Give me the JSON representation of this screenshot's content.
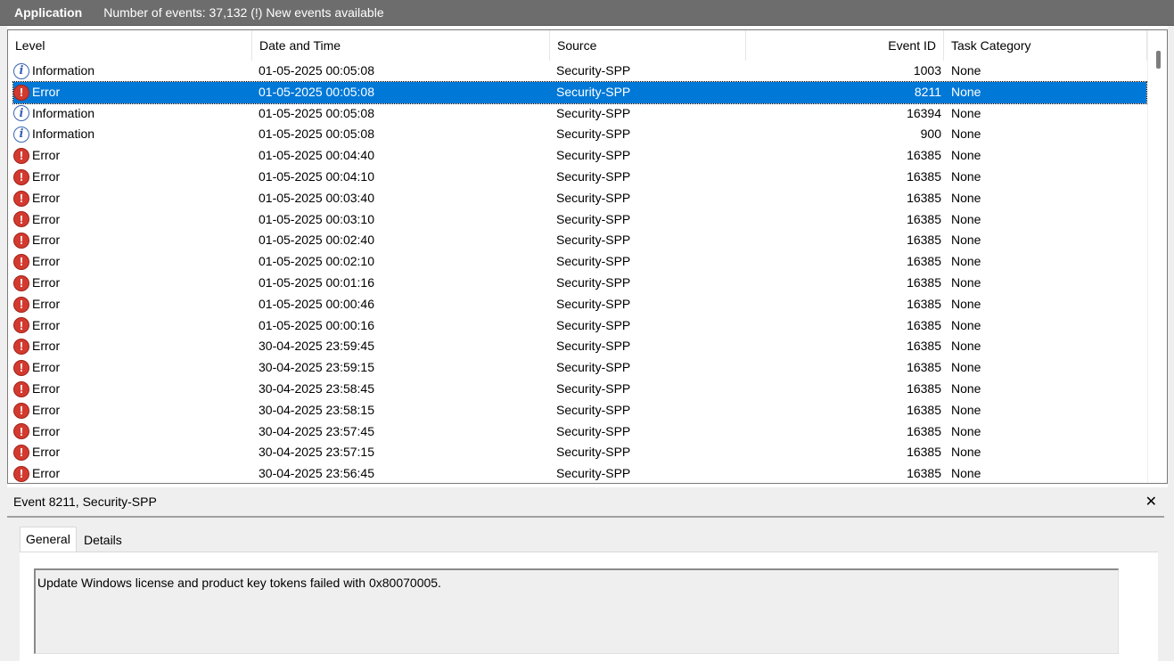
{
  "titlebar": {
    "log_name": "Application",
    "info": "Number of events: 37,132 (!) New events available"
  },
  "columns": {
    "level": "Level",
    "date": "Date and Time",
    "source": "Source",
    "event_id": "Event ID",
    "task": "Task Category"
  },
  "events": [
    {
      "level": "Information",
      "icon": "info",
      "date": "01-05-2025 00:05:08",
      "source": "Security-SPP",
      "id": "1003",
      "task": "None"
    },
    {
      "level": "Error",
      "icon": "error",
      "date": "01-05-2025 00:05:08",
      "source": "Security-SPP",
      "id": "8211",
      "task": "None",
      "selected": true
    },
    {
      "level": "Information",
      "icon": "info",
      "date": "01-05-2025 00:05:08",
      "source": "Security-SPP",
      "id": "16394",
      "task": "None"
    },
    {
      "level": "Information",
      "icon": "info",
      "date": "01-05-2025 00:05:08",
      "source": "Security-SPP",
      "id": "900",
      "task": "None"
    },
    {
      "level": "Error",
      "icon": "error",
      "date": "01-05-2025 00:04:40",
      "source": "Security-SPP",
      "id": "16385",
      "task": "None"
    },
    {
      "level": "Error",
      "icon": "error",
      "date": "01-05-2025 00:04:10",
      "source": "Security-SPP",
      "id": "16385",
      "task": "None"
    },
    {
      "level": "Error",
      "icon": "error",
      "date": "01-05-2025 00:03:40",
      "source": "Security-SPP",
      "id": "16385",
      "task": "None"
    },
    {
      "level": "Error",
      "icon": "error",
      "date": "01-05-2025 00:03:10",
      "source": "Security-SPP",
      "id": "16385",
      "task": "None"
    },
    {
      "level": "Error",
      "icon": "error",
      "date": "01-05-2025 00:02:40",
      "source": "Security-SPP",
      "id": "16385",
      "task": "None"
    },
    {
      "level": "Error",
      "icon": "error",
      "date": "01-05-2025 00:02:10",
      "source": "Security-SPP",
      "id": "16385",
      "task": "None"
    },
    {
      "level": "Error",
      "icon": "error",
      "date": "01-05-2025 00:01:16",
      "source": "Security-SPP",
      "id": "16385",
      "task": "None"
    },
    {
      "level": "Error",
      "icon": "error",
      "date": "01-05-2025 00:00:46",
      "source": "Security-SPP",
      "id": "16385",
      "task": "None"
    },
    {
      "level": "Error",
      "icon": "error",
      "date": "01-05-2025 00:00:16",
      "source": "Security-SPP",
      "id": "16385",
      "task": "None"
    },
    {
      "level": "Error",
      "icon": "error",
      "date": "30-04-2025 23:59:45",
      "source": "Security-SPP",
      "id": "16385",
      "task": "None"
    },
    {
      "level": "Error",
      "icon": "error",
      "date": "30-04-2025 23:59:15",
      "source": "Security-SPP",
      "id": "16385",
      "task": "None"
    },
    {
      "level": "Error",
      "icon": "error",
      "date": "30-04-2025 23:58:45",
      "source": "Security-SPP",
      "id": "16385",
      "task": "None"
    },
    {
      "level": "Error",
      "icon": "error",
      "date": "30-04-2025 23:58:15",
      "source": "Security-SPP",
      "id": "16385",
      "task": "None"
    },
    {
      "level": "Error",
      "icon": "error",
      "date": "30-04-2025 23:57:45",
      "source": "Security-SPP",
      "id": "16385",
      "task": "None"
    },
    {
      "level": "Error",
      "icon": "error",
      "date": "30-04-2025 23:57:15",
      "source": "Security-SPP",
      "id": "16385",
      "task": "None"
    },
    {
      "level": "Error",
      "icon": "error",
      "date": "30-04-2025 23:56:45",
      "source": "Security-SPP",
      "id": "16385",
      "task": "None"
    }
  ],
  "detail": {
    "title": "Event 8211, Security-SPP",
    "close_glyph": "✕",
    "tabs": [
      "General",
      "Details"
    ],
    "message": "Update Windows license and product key tokens failed with 0x80070005."
  }
}
